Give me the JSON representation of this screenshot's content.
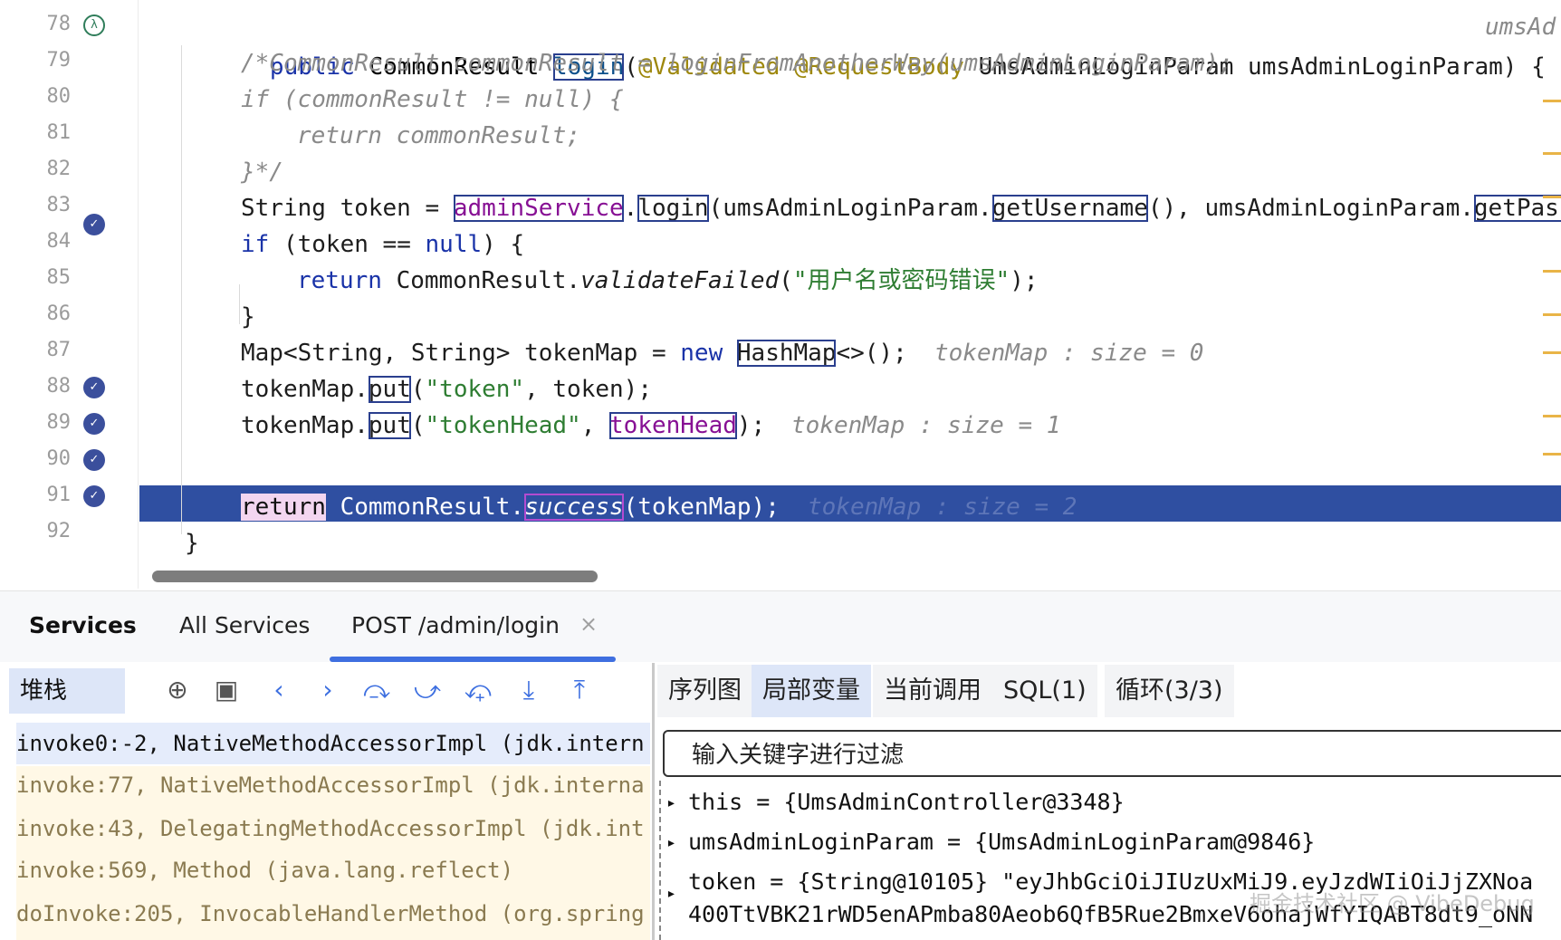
{
  "editor": {
    "line_numbers": [
      "78",
      "79",
      "80",
      "81",
      "82",
      "83",
      "84",
      "85",
      "86",
      "87",
      "88",
      "89",
      "90",
      "91",
      "92"
    ],
    "lines": {
      "l78": {
        "kw": "public ",
        "type": "CommonResult ",
        "method": "login",
        "open": "(",
        "ann": "@Validated @RequestBody ",
        "rest": "UmsAdminLoginParam umsAdminLoginParam) {",
        "hint": "umsAd"
      },
      "l79": "/*CommonResult commonResult = loginFromAnotherWay(umsAdminLoginParam);",
      "l80": "if (commonResult != null) {",
      "l81": "return commonResult;",
      "l82": "}*/",
      "l83": {
        "a": "String token = ",
        "field": "adminService",
        "dot": ".",
        "m": "login",
        "b": "(umsAdminLoginParam.",
        "m2": "getUsername",
        "c": "(), umsAdminLoginParam.",
        "m3": "getPass"
      },
      "l84": {
        "kw": "if ",
        "a": "(token == ",
        "kw2": "null",
        "b": ") {"
      },
      "l85": {
        "kw": "return ",
        "a": "CommonResult.",
        "m": "validateFailed",
        "b": "(",
        "str": "\"用户名或密码错误\"",
        "c": ");"
      },
      "l86": "}",
      "l87": {
        "a": "Map<String, String> tokenMap = ",
        "kw": "new ",
        "cls": "HashMap",
        "b": "<>();",
        "hint": "tokenMap : size = 0"
      },
      "l88": {
        "a": "tokenMap.",
        "m": "put",
        "b": "(",
        "str": "\"token\"",
        "c": ", token);"
      },
      "l89": {
        "a": "tokenMap.",
        "m": "put",
        "b": "(",
        "str": "\"tokenHead\"",
        "c": ", ",
        "field": "tokenHead",
        "d": ");",
        "hint": "tokenMap : size = 1"
      },
      "l90": {
        "kw": "return",
        "a": " CommonResult.",
        "m": "success",
        "b": "(tokenMap);",
        "hint": "tokenMap : size = 2"
      },
      "l91": "}"
    }
  },
  "services": {
    "title": "Services",
    "tabs": [
      "All Services",
      "POST /admin/login"
    ],
    "close_glyph": "×"
  },
  "debugger": {
    "stack_tab": "堆栈",
    "toolbar_icons": [
      "target-icon",
      "layers-icon",
      "chevron-left-icon",
      "chevron-right-icon",
      "step-over-icon",
      "step-over-alt-icon",
      "step-into-my-code-icon",
      "step-into-icon",
      "step-out-icon"
    ],
    "frames": [
      "invoke0:-2, NativeMethodAccessorImpl (jdk.intern",
      "invoke:77, NativeMethodAccessorImpl (jdk.interna",
      "invoke:43, DelegatingMethodAccessorImpl (jdk.int",
      "invoke:569, Method (java.lang.reflect)",
      "doInvoke:205, InvocableHandlerMethod (org.spring"
    ],
    "var_tabs": [
      "序列图",
      "局部变量",
      "当前调用",
      "SQL(1)",
      "循环(3/3)"
    ],
    "filter_placeholder": "输入关键字进行过滤",
    "variables": [
      "this = {UmsAdminController@3348}",
      "umsAdminLoginParam = {UmsAdminLoginParam@9846}",
      "token = {String@10105} \"eyJhbGciOiJIUzUxMiJ9.eyJzdWIiOiJjZXNoa",
      "400TtVBK21rWD5enAPmba80Aeob6QfB5Rue2BmxeV6ohajWfYIQABT8dt9_oNN"
    ],
    "watermark": "掘金技术社区 @ VibeDebug"
  }
}
